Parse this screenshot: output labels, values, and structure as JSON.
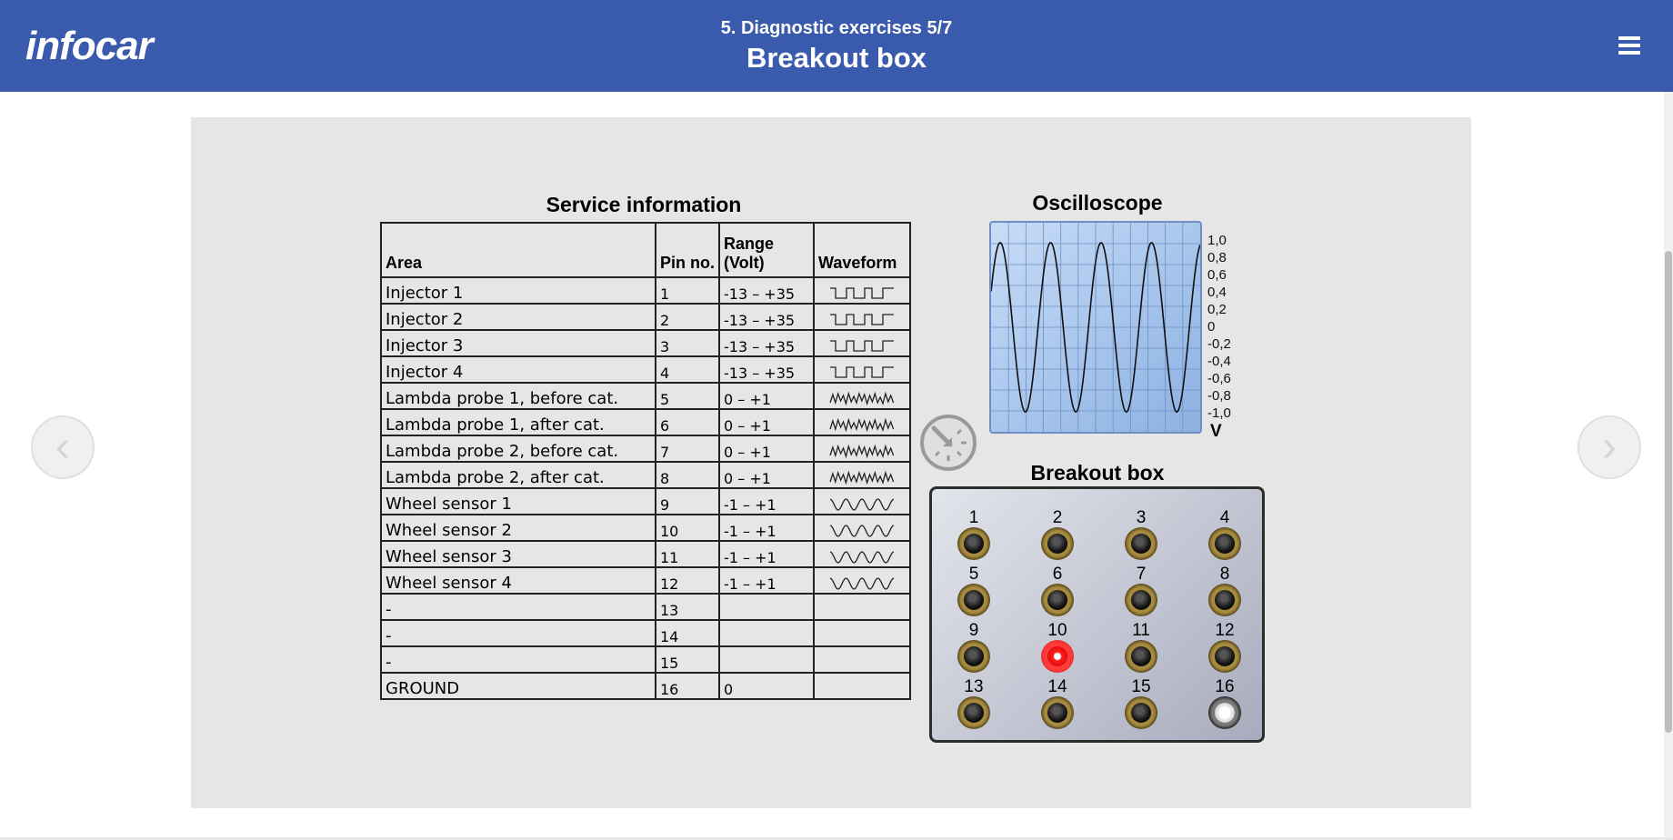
{
  "header": {
    "logo": "infocar",
    "subtitle": "5. Diagnostic exercises 5/7",
    "title": "Breakout box",
    "menu_icon": "hamburger-menu-icon"
  },
  "nav": {
    "prev": "‹",
    "next": "›"
  },
  "service_info": {
    "title": "Service information",
    "headers": {
      "area": "Area",
      "pin": "Pin no.",
      "range": "Range (Volt)",
      "waveform": "Waveform"
    },
    "rows": [
      {
        "area": "Injector 1",
        "pin": "1",
        "range": "-13 – +35",
        "waveform": "square"
      },
      {
        "area": "Injector 2",
        "pin": "2",
        "range": "-13 – +35",
        "waveform": "square"
      },
      {
        "area": "Injector 3",
        "pin": "3",
        "range": "-13 – +35",
        "waveform": "square"
      },
      {
        "area": "Injector 4",
        "pin": "4",
        "range": "-13 – +35",
        "waveform": "square"
      },
      {
        "area": "Lambda probe 1, before cat.",
        "pin": "5",
        "range": "0 – +1",
        "waveform": "noise"
      },
      {
        "area": "Lambda probe 1, after cat.",
        "pin": "6",
        "range": "0 – +1",
        "waveform": "noise"
      },
      {
        "area": "Lambda probe 2, before cat.",
        "pin": "7",
        "range": "0 – +1",
        "waveform": "noise"
      },
      {
        "area": "Lambda probe 2, after cat.",
        "pin": "8",
        "range": "0 – +1",
        "waveform": "noise"
      },
      {
        "area": "Wheel sensor 1",
        "pin": "9",
        "range": "-1 – +1",
        "waveform": "sine"
      },
      {
        "area": "Wheel sensor 2",
        "pin": "10",
        "range": "-1 – +1",
        "waveform": "sine"
      },
      {
        "area": "Wheel sensor 3",
        "pin": "11",
        "range": "-1 – +1",
        "waveform": "sine"
      },
      {
        "area": "Wheel sensor 4",
        "pin": "12",
        "range": "-1 – +1",
        "waveform": "sine"
      },
      {
        "area": "-",
        "pin": "13",
        "range": "",
        "waveform": ""
      },
      {
        "area": "-",
        "pin": "14",
        "range": "",
        "waveform": ""
      },
      {
        "area": "-",
        "pin": "15",
        "range": "",
        "waveform": ""
      },
      {
        "area": "GROUND",
        "pin": "16",
        "range": "0",
        "waveform": ""
      }
    ]
  },
  "oscilloscope": {
    "title": "Oscilloscope",
    "scale": [
      "1,0",
      "0,8",
      "0,6",
      "0,4",
      "0,2",
      "0",
      "-0,2",
      "-0,4",
      "-0,6",
      "-0,8",
      "-1,0"
    ],
    "unit": "V",
    "signal": {
      "type": "sine",
      "cycles": 4,
      "amplitude": 0.95
    }
  },
  "breakout_box": {
    "title": "Breakout box",
    "pins": [
      {
        "label": "1",
        "state": "normal"
      },
      {
        "label": "2",
        "state": "normal"
      },
      {
        "label": "3",
        "state": "normal"
      },
      {
        "label": "4",
        "state": "normal"
      },
      {
        "label": "5",
        "state": "normal"
      },
      {
        "label": "6",
        "state": "normal"
      },
      {
        "label": "7",
        "state": "normal"
      },
      {
        "label": "8",
        "state": "normal"
      },
      {
        "label": "9",
        "state": "normal"
      },
      {
        "label": "10",
        "state": "active"
      },
      {
        "label": "11",
        "state": "normal"
      },
      {
        "label": "12",
        "state": "normal"
      },
      {
        "label": "13",
        "state": "normal"
      },
      {
        "label": "14",
        "state": "normal"
      },
      {
        "label": "15",
        "state": "normal"
      },
      {
        "label": "16",
        "state": "ground"
      }
    ]
  }
}
